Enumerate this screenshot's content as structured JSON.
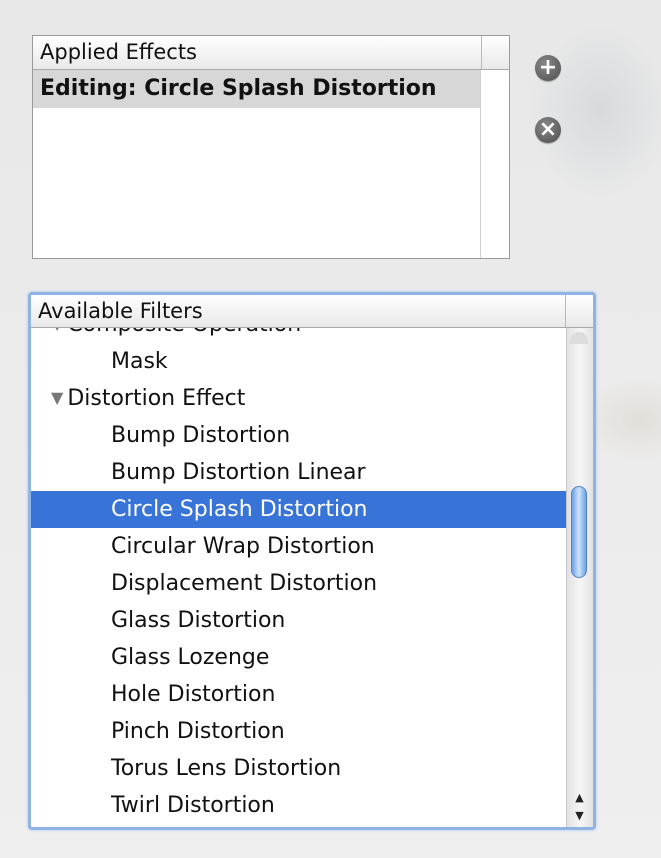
{
  "applied_effects": {
    "header": "Applied Effects",
    "rows": [
      "Editing: Circle Splash Distortion"
    ],
    "add_button": "+",
    "remove_button": "×"
  },
  "available_filters": {
    "header": "Available Filters",
    "items": [
      {
        "label": "Composite Operation",
        "type": "category"
      },
      {
        "label": "Mask",
        "type": "filter"
      },
      {
        "label": "Distortion Effect",
        "type": "category"
      },
      {
        "label": "Bump Distortion",
        "type": "filter"
      },
      {
        "label": "Bump Distortion Linear",
        "type": "filter"
      },
      {
        "label": "Circle Splash Distortion",
        "type": "filter",
        "selected": true
      },
      {
        "label": "Circular Wrap Distortion",
        "type": "filter"
      },
      {
        "label": "Displacement Distortion",
        "type": "filter"
      },
      {
        "label": "Glass Distortion",
        "type": "filter"
      },
      {
        "label": "Glass Lozenge",
        "type": "filter"
      },
      {
        "label": "Hole Distortion",
        "type": "filter"
      },
      {
        "label": "Pinch Distortion",
        "type": "filter"
      },
      {
        "label": "Torus Lens Distortion",
        "type": "filter"
      },
      {
        "label": "Twirl Distortion",
        "type": "filter"
      }
    ]
  },
  "colors": {
    "selection": "#3874d7",
    "focus_ring": "#8fb3e2"
  },
  "icons": {
    "add": "plus-circle-icon",
    "remove": "x-circle-icon",
    "disclosure": "triangle-down-icon"
  }
}
